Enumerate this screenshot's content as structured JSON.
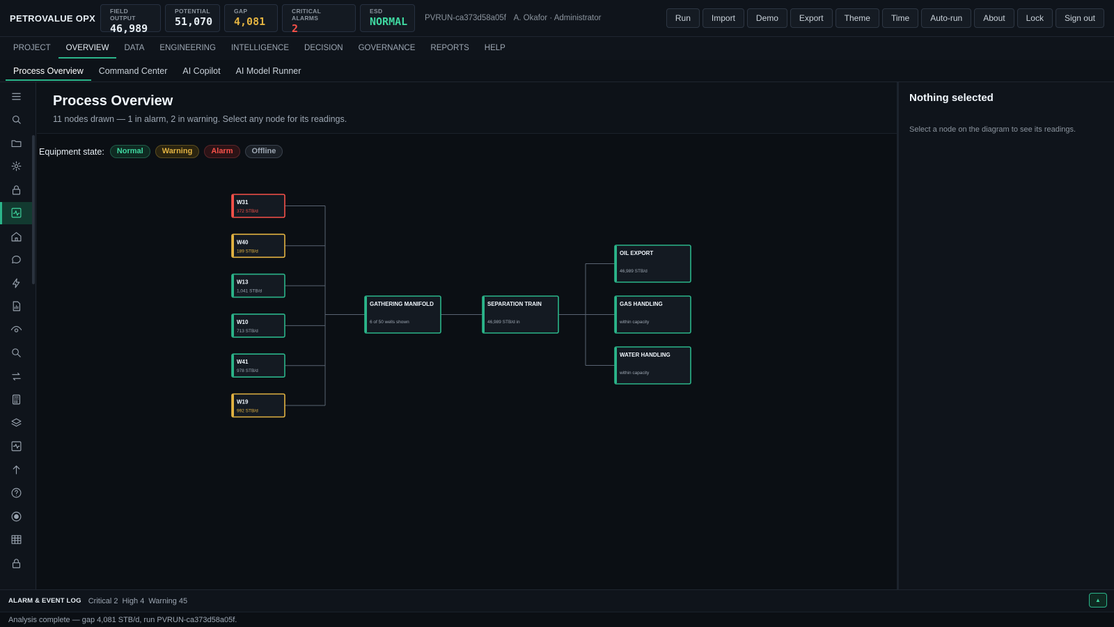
{
  "app": {
    "brand": "PETROVALUE OPX"
  },
  "kpis": [
    {
      "label": "FIELD OUTPUT",
      "value": "46,989",
      "tone": "normal"
    },
    {
      "label": "POTENTIAL",
      "value": "51,070",
      "tone": "normal"
    },
    {
      "label": "GAP",
      "value": "4,081",
      "tone": "warn"
    },
    {
      "label": "CRITICAL ALARMS",
      "value": "2",
      "tone": "alarm"
    },
    {
      "label": "ESD",
      "value": "NORMAL",
      "tone": "ok"
    }
  ],
  "run": {
    "id": "PVRUN-ca373d58a05f",
    "user": "A. Okafor · Administrator"
  },
  "actions": [
    "Run",
    "Import",
    "Demo",
    "Export",
    "Theme",
    "Time",
    "Auto-run",
    "About",
    "Lock",
    "Sign out"
  ],
  "main_nav": [
    "PROJECT",
    "OVERVIEW",
    "DATA",
    "ENGINEERING",
    "INTELLIGENCE",
    "DECISION",
    "GOVERNANCE",
    "REPORTS",
    "HELP"
  ],
  "main_nav_active": 1,
  "sub_nav": [
    "Process Overview",
    "Command Center",
    "AI Copilot",
    "AI Model Runner"
  ],
  "sub_nav_active": 0,
  "rail_icons": [
    "menu-icon",
    "search-icon",
    "folder-icon",
    "gear-icon",
    "lock-icon",
    "activity-icon",
    "home-icon",
    "chat-icon",
    "bolt-icon",
    "report-icon",
    "eye-icon",
    "zoom-icon",
    "swap-icon",
    "calculator-icon",
    "layers-icon",
    "pulse-icon",
    "arrow-up-icon",
    "help-icon",
    "record-icon",
    "grid-icon",
    "lock-icon"
  ],
  "rail_active": 5,
  "page": {
    "title": "Process Overview",
    "subtitle": "11 nodes drawn — 1 in alarm, 2 in warning. Select any node for its readings."
  },
  "legend": {
    "caption": "Equipment state:",
    "states": [
      {
        "label": "Normal",
        "kind": "normal"
      },
      {
        "label": "Warning",
        "kind": "warning"
      },
      {
        "label": "Alarm",
        "kind": "alarm"
      },
      {
        "label": "Offline",
        "kind": "offline"
      }
    ]
  },
  "diagram": {
    "wells": [
      {
        "name": "W31",
        "rate": "372 STB/d",
        "state": "alarm"
      },
      {
        "name": "W40",
        "rate": "189 STB/d",
        "state": "warning"
      },
      {
        "name": "W13",
        "rate": "1,041 STB/d",
        "state": "normal"
      },
      {
        "name": "W10",
        "rate": "713 STB/d",
        "state": "normal"
      },
      {
        "name": "W41",
        "rate": "978 STB/d",
        "state": "normal"
      },
      {
        "name": "W19",
        "rate": "992 STB/d",
        "state": "warning"
      }
    ],
    "manifold": {
      "name": "GATHERING MANIFOLD",
      "detail": "6 of 50 wells shown",
      "state": "normal"
    },
    "separator": {
      "name": "SEPARATION TRAIN",
      "detail": "46,989 STB/d in",
      "state": "normal"
    },
    "outputs": [
      {
        "name": "OIL EXPORT",
        "detail": "46,989 STB/d",
        "state": "normal"
      },
      {
        "name": "GAS HANDLING",
        "detail": "within capacity",
        "state": "normal"
      },
      {
        "name": "WATER HANDLING",
        "detail": "within capacity",
        "state": "normal"
      }
    ]
  },
  "side_panel": {
    "title": "Nothing selected",
    "hint": "Select a node on the diagram to see its readings."
  },
  "alarm_log": {
    "title": "ALARM & EVENT LOG",
    "counts": [
      "Critical 2",
      "High 4",
      "Warning 45"
    ],
    "toggle": "▲"
  },
  "status": "Analysis complete — gap 4,081 STB/d, run PVRUN-ca373d58a05f.",
  "colors": {
    "accent": "#2bb58a",
    "alarm": "#f85149",
    "warning": "#e3b341",
    "background": "#0d1117"
  }
}
